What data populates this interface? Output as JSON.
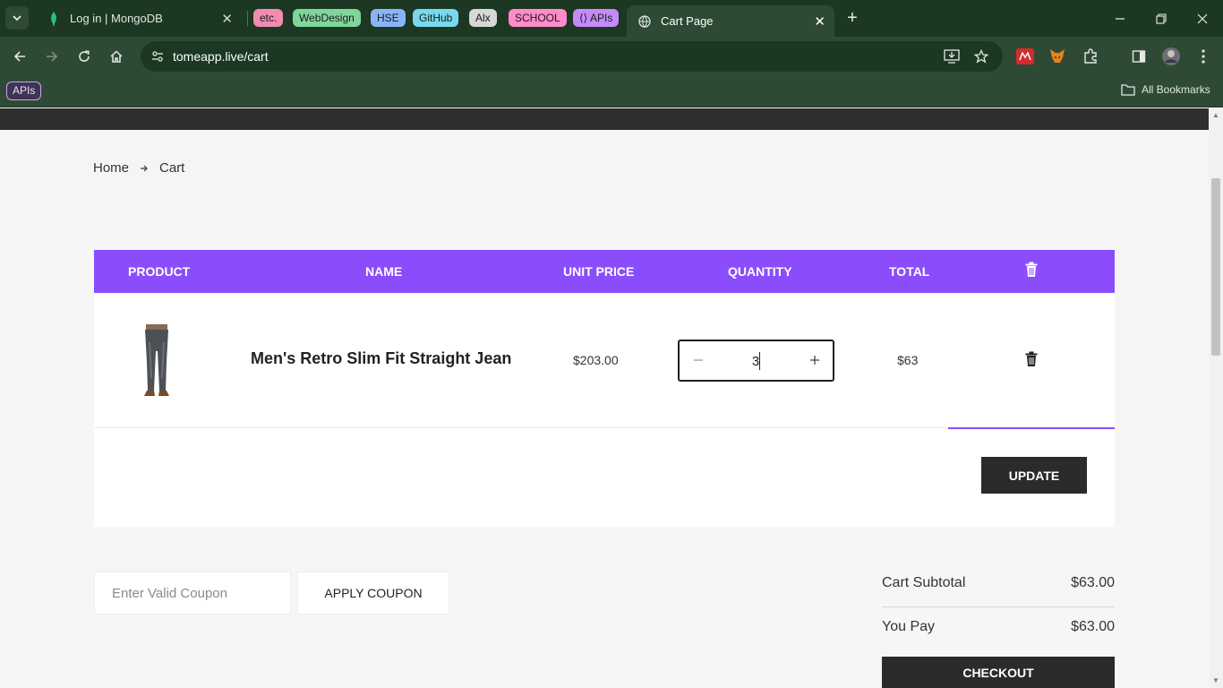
{
  "browser": {
    "tabs": [
      {
        "title": "Log in | MongoDB",
        "icon": "leaf-icon",
        "active": false
      },
      {
        "title": "Cart Page",
        "icon": "globe-icon",
        "active": true
      }
    ],
    "tab_groups": [
      {
        "label": "etc.",
        "color": "#f28bb1"
      },
      {
        "label": "WebDesign",
        "color": "#7fd69b"
      },
      {
        "label": "HSE",
        "color": "#8ab4f8"
      },
      {
        "label": "GitHub",
        "color": "#78d9ec"
      },
      {
        "label": "Alx",
        "color": "#d7d7d7"
      },
      {
        "label": "SCHOOL",
        "color": "#ff8bcb"
      },
      {
        "label": "APIs",
        "color": "#c58af9"
      }
    ],
    "url": "tomeapp.live/cart",
    "bookmark_group": "APIs",
    "all_bookmarks": "All Bookmarks"
  },
  "page": {
    "breadcrumb": {
      "home": "Home",
      "current": "Cart"
    },
    "table": {
      "headers": {
        "product": "PRODUCT",
        "name": "NAME",
        "unit_price": "UNIT PRICE",
        "quantity": "QUANTITY",
        "total": "TOTAL"
      },
      "rows": [
        {
          "name": "Men's Retro Slim Fit Straight Jean",
          "unit_price": "$203.00",
          "quantity": "3",
          "total": "$63"
        }
      ]
    },
    "update_label": "UPDATE",
    "coupon": {
      "placeholder": "Enter Valid Coupon",
      "button": "APPLY COUPON"
    },
    "summary": {
      "subtotal_label": "Cart Subtotal",
      "subtotal_value": "$63.00",
      "pay_label": "You Pay",
      "pay_value": "$63.00"
    },
    "checkout_label": "CHECKOUT",
    "accent_color": "#8b4dfc"
  }
}
